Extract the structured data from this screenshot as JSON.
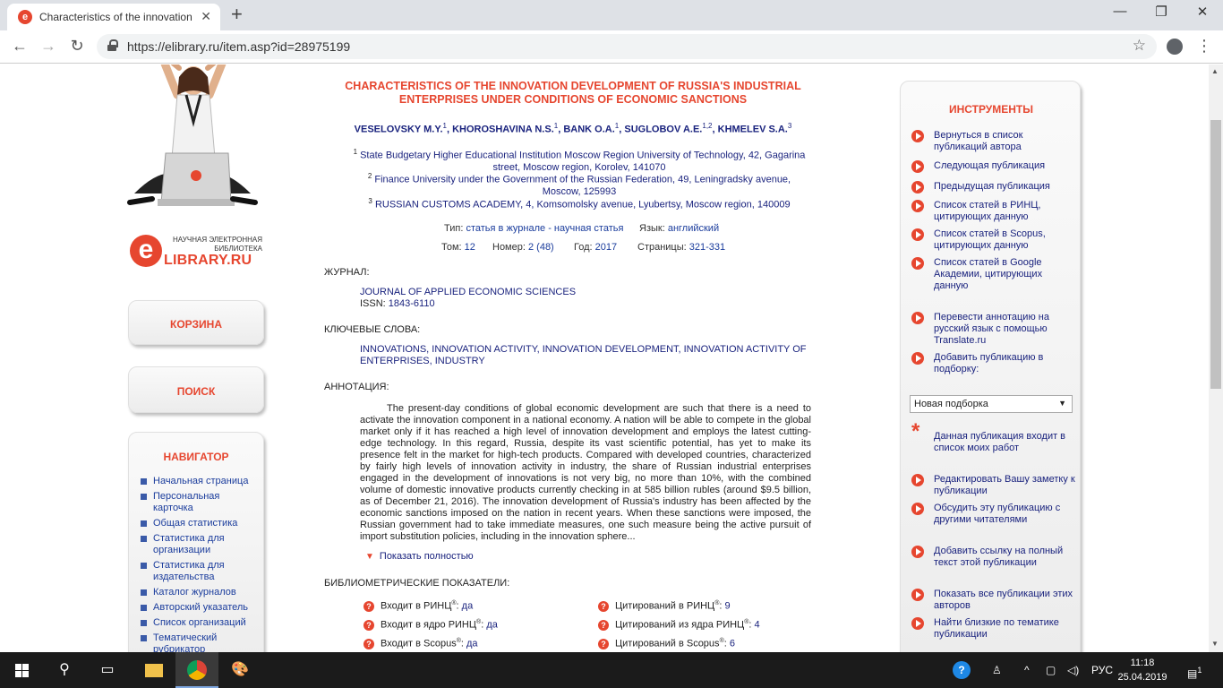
{
  "browser": {
    "tab_title": "Characteristics of the innovation",
    "url": "https://elibrary.ru/item.asp?id=28975199"
  },
  "left": {
    "logo_top": "НАУЧНАЯ ЭЛЕКТРОННАЯ БИБЛИОТЕКА",
    "logo_main_1": "LIBRARY",
    "logo_main_2": ".RU",
    "cart": "КОРЗИНА",
    "search": "ПОИСК",
    "navigator_title": "НАВИГАТОР",
    "nav_items": [
      "Начальная страница",
      "Персональная карточка",
      "Общая статистика",
      "Статистика для организации",
      "Статистика для издательства",
      "Каталог журналов",
      "Авторский указатель",
      "Список организаций",
      "Тематический рубрикатор"
    ]
  },
  "article": {
    "title": "CHARACTERISTICS OF THE INNOVATION DEVELOPMENT OF RUSSIA'S INDUSTRIAL ENTERPRISES UNDER CONDITIONS OF ECONOMIC SANCTIONS",
    "authors": [
      {
        "name": "VESELOVSKY M.Y.",
        "sup": "1"
      },
      {
        "name": "KHOROSHAVINA N.S.",
        "sup": "1"
      },
      {
        "name": "BANK O.A.",
        "sup": "1"
      },
      {
        "name": "SUGLOBOV A.E.",
        "sup": "1,2"
      },
      {
        "name": "KHMELEV S.A.",
        "sup": "3"
      }
    ],
    "affiliations": [
      {
        "num": "1",
        "text": "State Budgetary Higher Educational Institution Moscow Region University of Technology",
        "rest": ", 42, Gagarina street, Moscow region, Korolev, 141070"
      },
      {
        "num": "2",
        "text": "Finance University under the Government of the Russian Federation",
        "rest": ", 49, Leningradsky avenue, Moscow, 125993"
      },
      {
        "num": "3",
        "text": "RUSSIAN CUSTOMS ACADEMY",
        "rest": ", 4, Komsomolsky avenue, Lyubertsy, Moscow region, 140009"
      }
    ],
    "type_label": "Тип:",
    "type_value": "статья в журнале - научная статья",
    "lang_label": "Язык:",
    "lang_value": "английский",
    "volume_label": "Том:",
    "volume_value": "12",
    "number_label": "Номер:",
    "number_value": "2 (48)",
    "year_label": "Год:",
    "year_value": "2017",
    "pages_label": "Страницы:",
    "pages_value": "321-331",
    "journal_header": "ЖУРНАЛ:",
    "journal_name": "JOURNAL OF APPLIED ECONOMIC SCIENCES",
    "issn_label": "ISSN:",
    "issn_value": "1843-6110",
    "keywords_header": "КЛЮЧЕВЫЕ СЛОВА:",
    "keywords": "INNOVATIONS, INNOVATION ACTIVITY, INNOVATION DEVELOPMENT, INNOVATION ACTIVITY OF ENTERPRISES, INDUSTRY",
    "abstract_header": "АННОТАЦИЯ:",
    "abstract": "The present-day conditions of global economic development are such that there is a need to activate the innovation component in a national economy. A nation will be able to compete in the global market only if it has reached a high level of innovation development and employs the latest cutting-edge technology. In this regard, Russia, despite its vast scientific potential, has yet to make its presence felt in the market for high-tech products. Compared with developed countries, characterized by fairly high levels of innovation activity in industry, the share of Russian industrial enterprises engaged in the development of innovations is not very big, no more than 10%, with the combined volume of domestic innovative products currently checking in at 585 billion rubles (around $9.5 billion, as of December 21, 2016). The innovation development of Russia's industry has been affected by the economic sanctions imposed on the nation in recent years. When these sanctions were imposed, the Russian government had to take immediate measures, one such measure being the active pursuit of import substitution policies, including in the innovation sphere...",
    "show_full": "Показать полностью",
    "biblio_header": "БИБЛИОМЕТРИЧЕСКИЕ ПОКАЗАТЕЛИ:",
    "metrics_left": [
      {
        "label": "Входит в РИНЦ",
        "value": "да"
      },
      {
        "label": "Входит в ядро РИНЦ",
        "value": "да"
      },
      {
        "label": "Входит в Scopus",
        "value": "да"
      }
    ],
    "metrics_right": [
      {
        "label": "Цитирований в РИНЦ",
        "value": "9"
      },
      {
        "label": "Цитирований из ядра РИНЦ",
        "value": "4"
      },
      {
        "label": "Цитирований в Scopus",
        "value": "6"
      }
    ]
  },
  "tools": {
    "title": "ИНСТРУМЕНТЫ",
    "items": [
      "Вернуться в список публикаций автора",
      "Следующая публикация",
      "Предыдущая публикация",
      "Список статей в РИНЦ, цитирующих данную",
      "Список статей в Scopus, цитирующих данную",
      "Список статей в Google Академии, цитирующих данную",
      "Перевести аннотацию на русский язык с помощью Translate.ru",
      "Добавить публикацию в подборку:",
      "Данная публикация входит в список моих работ",
      "Редактировать Вашу заметку к публикации",
      "Обсудить эту публикацию с другими читателями",
      "Добавить ссылку на полный текст этой публикации",
      "Показать все публикации этих авторов",
      "Найти близкие по тематике публикации"
    ],
    "collection_select": "Новая подборка"
  },
  "taskbar": {
    "lang": "РУС",
    "time": "11:18",
    "date": "25.04.2019",
    "notifications": "1"
  }
}
